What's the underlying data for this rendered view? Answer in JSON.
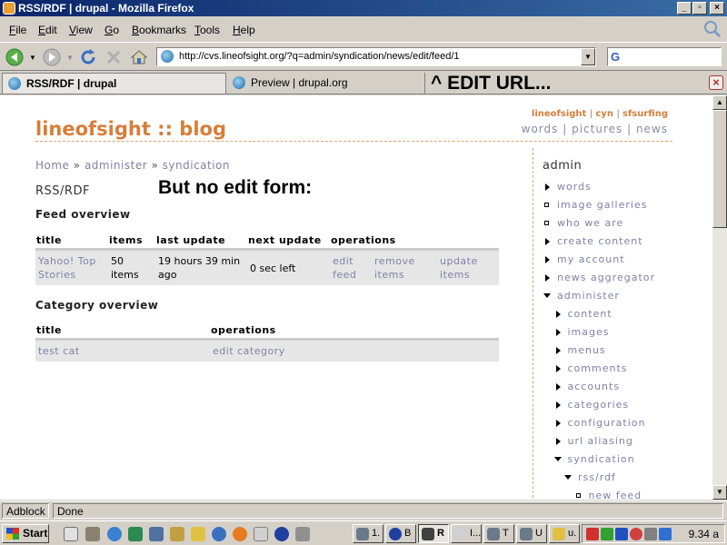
{
  "window": {
    "title": "RSS/RDF | drupal - Mozilla Firefox"
  },
  "menu": [
    "File",
    "Edit",
    "View",
    "Go",
    "Bookmarks",
    "Tools",
    "Help"
  ],
  "menu_accel": [
    "F",
    "E",
    "V",
    "G",
    "B",
    "T",
    "H"
  ],
  "menu_rest": [
    "ile",
    "dit",
    "iew",
    "o",
    "ookmarks",
    "ools",
    "elp"
  ],
  "url": "http://cvs.lineofsight.org/?q=admin/syndication/news/edit/feed/1",
  "tabs": [
    {
      "label": "RSS/RDF | drupal",
      "active": true
    },
    {
      "label": "Preview | drupal.org",
      "active": false
    }
  ],
  "annotations": {
    "edit_url": "^ EDIT URL...",
    "no_edit_form": "But no edit form:"
  },
  "site": {
    "title": "lineofsight :: blog",
    "top_links": [
      "lineofsight",
      "cyn",
      "sfsurfing"
    ],
    "nav_links": [
      "words",
      "pictures",
      "news"
    ]
  },
  "breadcrumb": [
    "Home",
    "administer",
    "syndication"
  ],
  "breadcrumb_sep": "»",
  "page_title": "RSS/RDF",
  "feed_overview": {
    "heading": "Feed overview",
    "columns": [
      "title",
      "items",
      "last update",
      "next update",
      "operations"
    ],
    "rows": [
      {
        "title": "Yahoo! Top Stories",
        "items": "50 items",
        "last_update": "19 hours 39 min ago",
        "next_update": "0 sec left",
        "ops": [
          "edit feed",
          "remove items",
          "update items"
        ]
      }
    ]
  },
  "category_overview": {
    "heading": "Category overview",
    "columns": [
      "title",
      "operations"
    ],
    "rows": [
      {
        "title": "test cat",
        "op": "edit category"
      }
    ]
  },
  "sidebar": {
    "title": "admin",
    "items": [
      {
        "label": "words",
        "marker": "collapsed",
        "level": 0
      },
      {
        "label": "image galleries",
        "marker": "leaf",
        "level": 0
      },
      {
        "label": "who we are",
        "marker": "leaf",
        "level": 0
      },
      {
        "label": "create content",
        "marker": "collapsed",
        "level": 0
      },
      {
        "label": "my account",
        "marker": "collapsed",
        "level": 0
      },
      {
        "label": "news aggregator",
        "marker": "collapsed",
        "level": 0
      },
      {
        "label": "administer",
        "marker": "expanded",
        "level": 0
      },
      {
        "label": "content",
        "marker": "collapsed",
        "level": 1
      },
      {
        "label": "images",
        "marker": "collapsed",
        "level": 1
      },
      {
        "label": "menus",
        "marker": "collapsed",
        "level": 1
      },
      {
        "label": "comments",
        "marker": "collapsed",
        "level": 1
      },
      {
        "label": "accounts",
        "marker": "collapsed",
        "level": 1
      },
      {
        "label": "categories",
        "marker": "collapsed",
        "level": 1
      },
      {
        "label": "configuration",
        "marker": "collapsed",
        "level": 1
      },
      {
        "label": "url aliasing",
        "marker": "collapsed",
        "level": 1
      },
      {
        "label": "syndication",
        "marker": "expanded",
        "level": 1
      },
      {
        "label": "rss/rdf",
        "marker": "expanded",
        "level": 2
      },
      {
        "label": "new feed",
        "marker": "leaf",
        "level": 3
      }
    ]
  },
  "status": {
    "adblock": "Adblock",
    "text": "Done"
  },
  "taskbar": {
    "start": "Start",
    "buttons": [
      "1.",
      "B",
      "R",
      "I...",
      "T",
      "U",
      "u."
    ],
    "clock": "9.34 a"
  },
  "colors": {
    "accent": "#d77e3a",
    "link": "#8080a8",
    "titlebar": "#0a246a"
  }
}
